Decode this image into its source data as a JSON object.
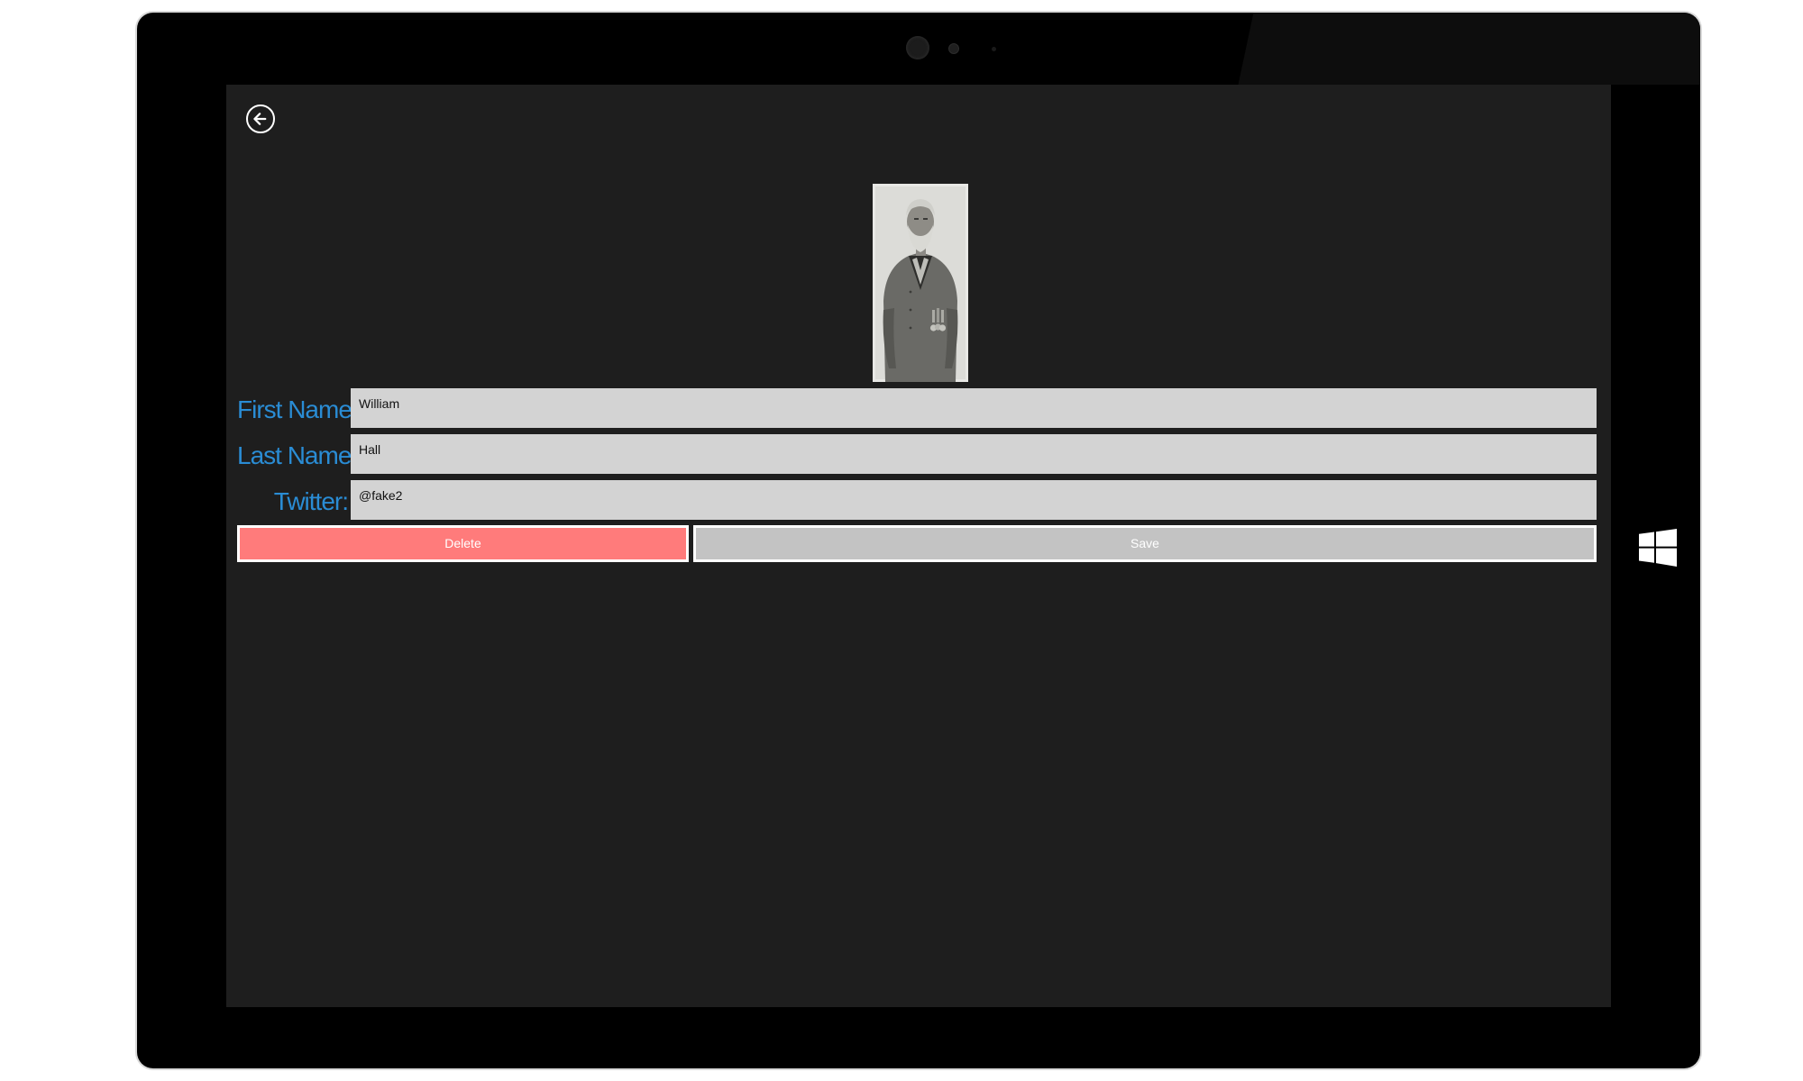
{
  "form": {
    "first_name": {
      "label": "First Name:",
      "value": "William"
    },
    "last_name": {
      "label": "Last Name:",
      "value": "Hall"
    },
    "twitter": {
      "label": "Twitter:",
      "value": "@fake2"
    }
  },
  "buttons": {
    "delete_label": "Delete",
    "save_label": "Save"
  },
  "icons": {
    "back": "arrow-left-circle-icon",
    "windows": "windows-logo-icon",
    "photo": "contact-portrait-photo"
  },
  "colors": {
    "screen_background": "#1e1e1e",
    "label_text": "#2a8cd4",
    "input_background": "#d3d3d3",
    "delete_button": "#ff7b7b",
    "save_button": "#c3c3c3",
    "device_bezel": "#000000"
  }
}
